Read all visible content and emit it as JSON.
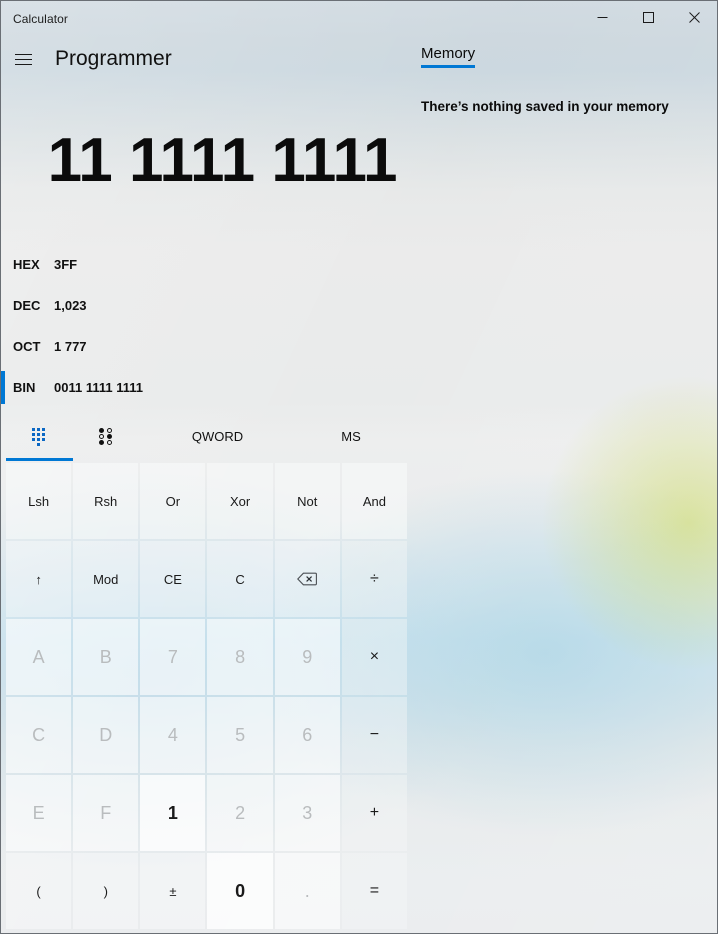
{
  "window": {
    "title": "Calculator",
    "caption_buttons": [
      {
        "name": "minimize",
        "label": "─"
      },
      {
        "name": "maximize",
        "label": "□"
      },
      {
        "name": "close",
        "label": "✕"
      }
    ]
  },
  "header": {
    "menu_icon": "hamburger-icon",
    "mode_title": "Programmer"
  },
  "memory": {
    "tab_label": "Memory",
    "empty_text": "There’s nothing saved in your memory"
  },
  "display": {
    "value": "11 1111 1111"
  },
  "radix": [
    {
      "label": "HEX",
      "value": "3FF",
      "selected": false
    },
    {
      "label": "DEC",
      "value": "1,023",
      "selected": false
    },
    {
      "label": "OCT",
      "value": "1 777",
      "selected": false
    },
    {
      "label": "BIN",
      "value": "0011 1111 1111",
      "selected": true
    }
  ],
  "keypad_tabs": {
    "items": [
      {
        "name": "keypad-tab",
        "icon": "keypad-grid-icon",
        "label": "",
        "active": true
      },
      {
        "name": "bit-toggle-tab",
        "icon": "bit-toggle-icon",
        "label": "",
        "active": false
      }
    ],
    "word_size": "QWORD",
    "memory_button": "MS"
  },
  "keys": [
    {
      "label": "Lsh",
      "name": "lsh",
      "kind": "bitop",
      "disabled": false
    },
    {
      "label": "Rsh",
      "name": "rsh",
      "kind": "bitop",
      "disabled": false
    },
    {
      "label": "Or",
      "name": "or",
      "kind": "bitop",
      "disabled": false
    },
    {
      "label": "Xor",
      "name": "xor",
      "kind": "bitop",
      "disabled": false
    },
    {
      "label": "Not",
      "name": "not",
      "kind": "bitop",
      "disabled": false
    },
    {
      "label": "And",
      "name": "and",
      "kind": "bitop",
      "disabled": false
    },
    {
      "label": "↑",
      "name": "rol-ror-toggle",
      "kind": "fn",
      "disabled": false
    },
    {
      "label": "Mod",
      "name": "mod",
      "kind": "fn",
      "disabled": false
    },
    {
      "label": "CE",
      "name": "clear-entry",
      "kind": "fn",
      "disabled": false
    },
    {
      "label": "C",
      "name": "clear",
      "kind": "fn",
      "disabled": false
    },
    {
      "label": "",
      "name": "backspace",
      "kind": "fn",
      "icon": "backspace-icon",
      "disabled": false
    },
    {
      "label": "÷",
      "name": "divide",
      "kind": "op",
      "disabled": false
    },
    {
      "label": "A",
      "name": "hex-a",
      "kind": "num",
      "disabled": true
    },
    {
      "label": "B",
      "name": "hex-b",
      "kind": "num",
      "disabled": true
    },
    {
      "label": "7",
      "name": "digit-7",
      "kind": "num",
      "disabled": true
    },
    {
      "label": "8",
      "name": "digit-8",
      "kind": "num",
      "disabled": true
    },
    {
      "label": "9",
      "name": "digit-9",
      "kind": "num",
      "disabled": true
    },
    {
      "label": "×",
      "name": "multiply",
      "kind": "op",
      "disabled": false
    },
    {
      "label": "C",
      "name": "hex-c",
      "kind": "num",
      "disabled": true
    },
    {
      "label": "D",
      "name": "hex-d",
      "kind": "num",
      "disabled": true
    },
    {
      "label": "4",
      "name": "digit-4",
      "kind": "num",
      "disabled": true
    },
    {
      "label": "5",
      "name": "digit-5",
      "kind": "num",
      "disabled": true
    },
    {
      "label": "6",
      "name": "digit-6",
      "kind": "num",
      "disabled": true
    },
    {
      "label": "−",
      "name": "subtract",
      "kind": "op",
      "disabled": false
    },
    {
      "label": "E",
      "name": "hex-e",
      "kind": "num",
      "disabled": true
    },
    {
      "label": "F",
      "name": "hex-f",
      "kind": "num",
      "disabled": true
    },
    {
      "label": "1",
      "name": "digit-1",
      "kind": "num",
      "disabled": false,
      "emphasis": "one"
    },
    {
      "label": "2",
      "name": "digit-2",
      "kind": "num",
      "disabled": true
    },
    {
      "label": "3",
      "name": "digit-3",
      "kind": "num",
      "disabled": true
    },
    {
      "label": "+",
      "name": "add",
      "kind": "op",
      "disabled": false
    },
    {
      "label": "(",
      "name": "open-paren",
      "kind": "fn",
      "disabled": false
    },
    {
      "label": ")",
      "name": "close-paren",
      "kind": "fn",
      "disabled": false
    },
    {
      "label": "±",
      "name": "negate",
      "kind": "fn",
      "disabled": false
    },
    {
      "label": "0",
      "name": "digit-0",
      "kind": "num",
      "disabled": false,
      "emphasis": "zero"
    },
    {
      "label": ".",
      "name": "decimal-point",
      "kind": "num",
      "disabled": true
    },
    {
      "label": "=",
      "name": "equals",
      "kind": "op",
      "disabled": false
    }
  ],
  "colors": {
    "accent": "#0078d4",
    "text": "#111111",
    "disabled_text": "#b9bcbe"
  }
}
